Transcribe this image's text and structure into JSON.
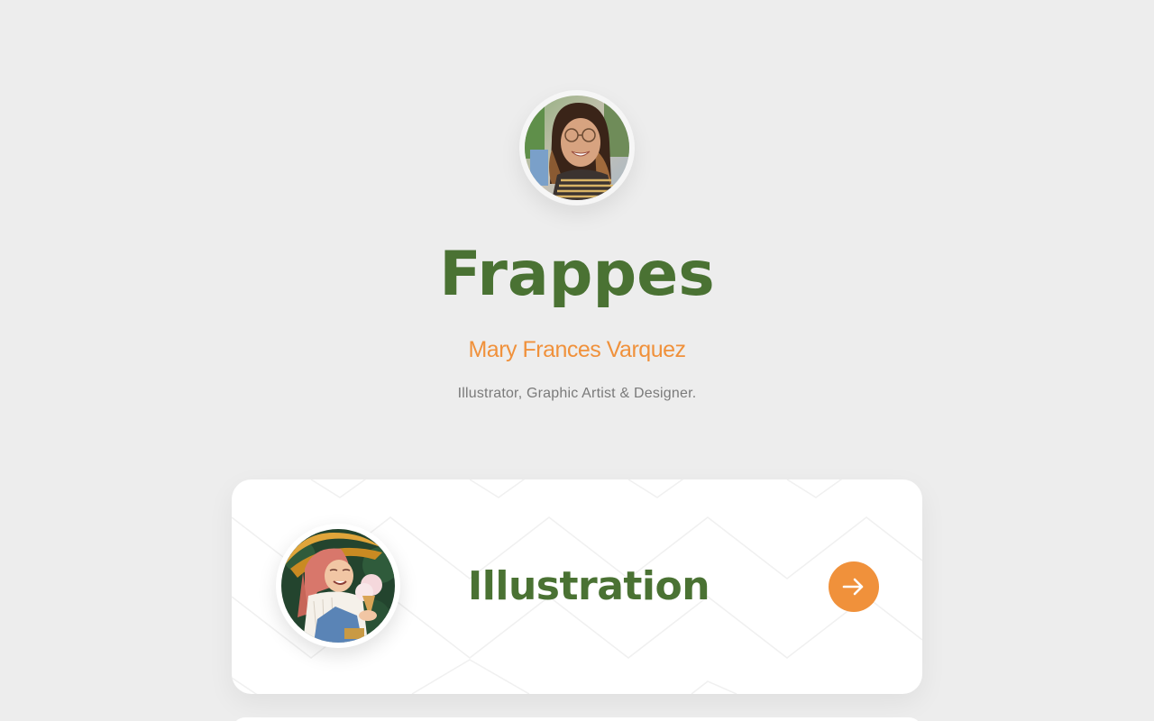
{
  "profile": {
    "title": "Frappes",
    "name": "Mary Frances Varquez",
    "tagline": "Illustrator, Graphic Artist & Designer.",
    "avatar_icon": "profile-photo"
  },
  "links": [
    {
      "label": "Illustration",
      "thumb_icon": "illustration-thumbnail",
      "action_icon": "arrow-right-icon"
    },
    {
      "label": ""
    }
  ],
  "colors": {
    "background": "#ededed",
    "title": "#4a7233",
    "accent": "#f0913b",
    "tagline": "#7a7a7a",
    "card": "#ffffff"
  }
}
